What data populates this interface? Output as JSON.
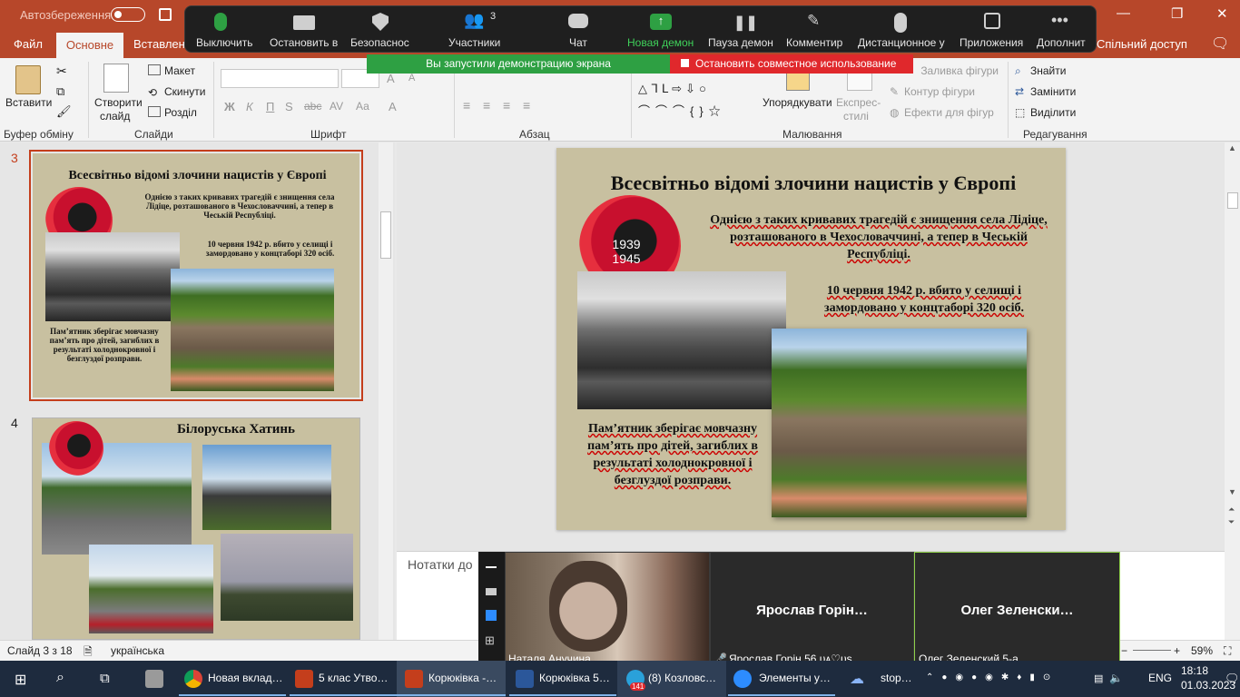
{
  "titlebar": {
    "autosave": "Автозбереження"
  },
  "tabs": {
    "file": "Файл",
    "home": "Основне",
    "insert": "Вставлення",
    "share": "Спільний доступ"
  },
  "zoom_toolbar": {
    "mute": "Выключить",
    "stop_video": "Остановить в",
    "security": "Безопаснос",
    "participants": "Участники",
    "participants_count": "3",
    "chat": "Чат",
    "new_share": "Новая демон",
    "pause_share": "Пауза демон",
    "annotate": "Комментир",
    "remote_control": "Дистанционное у",
    "apps": "Приложения",
    "more": "Дополнит",
    "sharing_banner": "Вы запустили демонстрацию экрана",
    "stop_share": "Остановить совместное использование"
  },
  "ribbon": {
    "paste": "Вставити",
    "clipboard": "Буфер обміну",
    "new_slide": "Створити",
    "new_slide2": "слайд",
    "layout": "Макет",
    "reset": "Скинути",
    "section": "Розділ",
    "slides": "Слайди",
    "font_group": "Шрифт",
    "paragraph": "Абзац",
    "arrange": "Упорядкувати",
    "quick_styles": "Експрес-",
    "quick_styles2": "стилі",
    "shape_fill": "Заливка фігури",
    "shape_outline": "Контур фігури",
    "shape_effects": "Ефекти для фігур",
    "drawing": "Малювання",
    "find": "Знайти",
    "replace": "Замінити",
    "select": "Виділити",
    "editing": "Редагування"
  },
  "thumbs": {
    "n3": "3",
    "n4": "4",
    "t3_title": "Всесвітньо відомі злочини нацистів у Європі",
    "t3_p1": "Однією з таких кривавих трагедій є знищення села Лідіце, розташованого в Чехословаччині, а тепер в Чеській Республіці.",
    "t3_p2": "10 червня 1942 р. вбито у селищі і замордовано у концтаборі 320 осіб.",
    "t3_p3": "Пам’ятник зберігає мовчазну пам’ять про дітей, загиблих в результаті холоднокровної і безглуздої розправи.",
    "t4_title": "Білоруська Хатинь"
  },
  "slide": {
    "title": "Всесвітньо відомі злочини нацистів у Європі",
    "poppy_top": "1939",
    "poppy_bottom": "1945",
    "p1": "Однією з таких кривавих трагедій є знищення села Лідіце, розташованого в Чехословаччині, а тепер в Чеській Республіці.",
    "p2": "10 червня 1942 р. вбито у селищі і замордовано у концтаборі 320 осіб.",
    "p3": "Пам’ятник зберігає мовчазну пам’ять про дітей, загиблих в результаті холоднокровної і безглуздої розправи."
  },
  "notes": {
    "placeholder": "Нотатки до"
  },
  "status": {
    "slide_counter": "Слайд 3 з 18",
    "language": "українська",
    "zoom": "59%"
  },
  "video": {
    "p1_name": "Наталя Анучина",
    "p2_big": "Ярослав  Горін…",
    "p2_label": "Ярослав Горін 56 ᴜᴀ♡ᴜs",
    "p3_big": "Олег  Зеленски…",
    "p3_label": "Олег Зеленский 5-а"
  },
  "taskbar": {
    "chrome": "Новая вклад…",
    "ppt1": "5 клас Утво…",
    "ppt2": "Корюківка -…",
    "word": "Корюківка 5…",
    "telegram": "(8) Козловс…",
    "telegram_badge": "141",
    "zoom": "Элементы у…",
    "stop": "stop…",
    "lang": "ENG",
    "time": "18:18",
    "date": "01.03.2023"
  },
  "colors": {
    "ppt_red": "#b7472a",
    "zoom_green": "#2ea043",
    "stop_red": "#e0282c",
    "slide_bg": "#c8c0a0"
  }
}
